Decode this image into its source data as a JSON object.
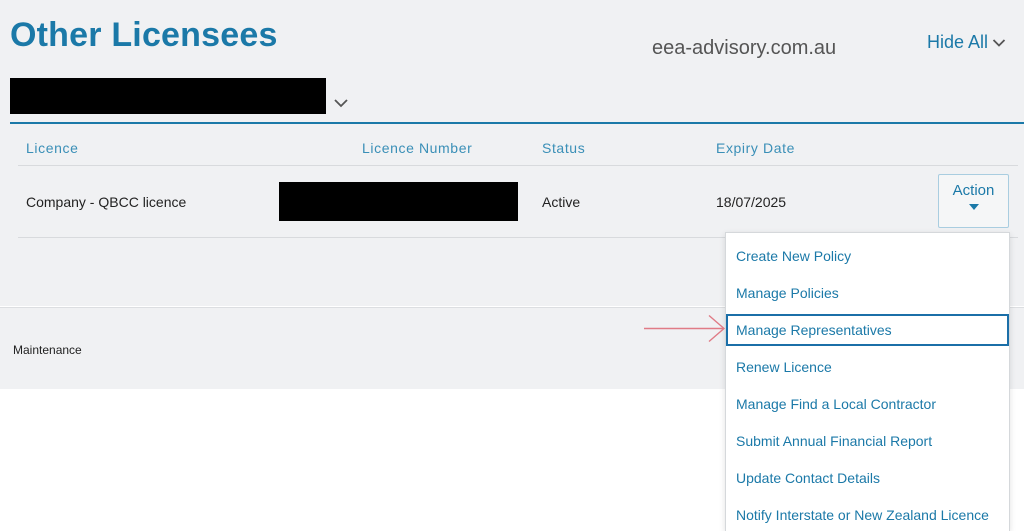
{
  "header": {
    "title": "Other Licensees",
    "domain": "eea-advisory.com.au",
    "hide_all_label": "Hide All"
  },
  "table": {
    "columns": [
      "Licence",
      "Licence Number",
      "Status",
      "Expiry Date"
    ],
    "rows": [
      {
        "licence": "Company - QBCC licence",
        "licence_number": "",
        "status": "Active",
        "expiry_date": "18/07/2025",
        "action_label": "Action"
      }
    ]
  },
  "footer": {
    "label": "Maintenance"
  },
  "action_menu": {
    "items": [
      "Create New Policy",
      "Manage Policies",
      "Manage Representatives",
      "Renew Licence",
      "Manage Find a Local Contractor",
      "Submit Annual Financial Report",
      "Update Contact Details",
      "Notify Interstate or New Zealand Licence"
    ],
    "highlighted_item": "Manage Representatives"
  },
  "icons": {
    "hide_all": "chevron-down-icon",
    "company_select": "chevron-down-icon",
    "action_caret": "caret-down-icon",
    "annotation": "arrow-right-icon"
  },
  "colors": {
    "accent": "#1b79a8",
    "header_text": "#3a8fb7",
    "panel_bg": "#f0f1f3",
    "annotation_arrow": "#e07b86",
    "redaction": "#000000"
  }
}
